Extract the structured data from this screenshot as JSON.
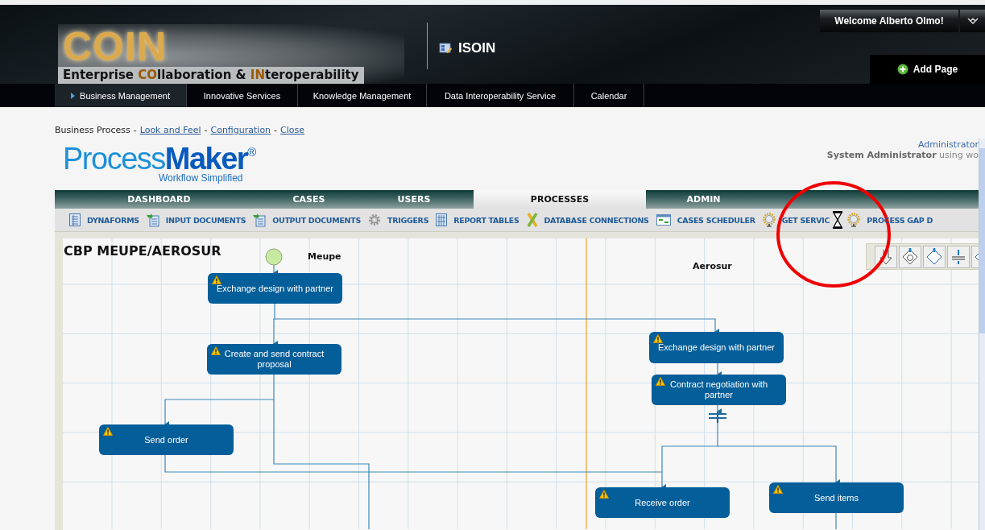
{
  "header": {
    "logo": {
      "title": "COIN",
      "tagline": [
        {
          "text": "Enterprise ",
          "highlight": false
        },
        {
          "text": "CO",
          "highlight": true
        },
        {
          "text": "llaboration & ",
          "highlight": false
        },
        {
          "text": "IN",
          "highlight": true
        },
        {
          "text": "teroperability",
          "highlight": false
        }
      ]
    },
    "site": "ISOIN",
    "welcome": "Welcome Alberto Olmo!",
    "add_page": "Add Page"
  },
  "nav": [
    {
      "label": "Business Management",
      "selected": true
    },
    {
      "label": "Innovative Services",
      "selected": false
    },
    {
      "label": "Knowledge Management",
      "selected": false
    },
    {
      "label": "Data Interoperability Service",
      "selected": false
    },
    {
      "label": "Calendar",
      "selected": false
    }
  ],
  "breadcrumb": [
    {
      "kind": "label",
      "text": "Business Process"
    },
    {
      "kind": "separator",
      "text": "-"
    },
    {
      "kind": "link",
      "text": "Look and Feel"
    },
    {
      "kind": "separator",
      "text": "-"
    },
    {
      "kind": "link",
      "text": "Configuration"
    },
    {
      "kind": "separator",
      "text": "-"
    },
    {
      "kind": "link",
      "text": "Close"
    }
  ],
  "product_logo": {
    "light": "Process",
    "bold": "Maker",
    "mark": "®",
    "tagline": "Workflow Simplified"
  },
  "user": {
    "role": "Administrator",
    "name": "System Administrator",
    "note": "using wo"
  },
  "tabs": [
    {
      "label": "DASHBOARD",
      "selected": false
    },
    {
      "label": "CASES",
      "selected": false
    },
    {
      "label": "USERS",
      "selected": false
    },
    {
      "label": "PROCESSES",
      "selected": true
    },
    {
      "label": "ADMIN",
      "selected": false
    }
  ],
  "toolbar": [
    "DYNAFORMS",
    "INPUT DOCUMENTS",
    "OUTPUT DOCUMENTS",
    "TRIGGERS",
    "REPORT TABLES",
    "DATABASE CONNECTIONS",
    "CASES SCHEDULER",
    "GET SERVIC",
    "PROCESS GAP D"
  ],
  "diagram": {
    "title": "CBP MEUPE/AEROSUR",
    "lanes": [
      {
        "name": "Meupe"
      },
      {
        "name": "Aerosur"
      }
    ],
    "tasks": [
      {
        "label": "Exchange design with partner",
        "warning": true
      },
      {
        "label": "Create and send contract proposal",
        "warning": true
      },
      {
        "label": "Send order",
        "warning": true
      },
      {
        "label": "Exchange design with partner",
        "warning": true
      },
      {
        "label": "Contract negotiation with partner",
        "warning": true
      },
      {
        "label": "Receive order",
        "warning": true
      },
      {
        "label": "Send items",
        "warning": true
      }
    ]
  }
}
